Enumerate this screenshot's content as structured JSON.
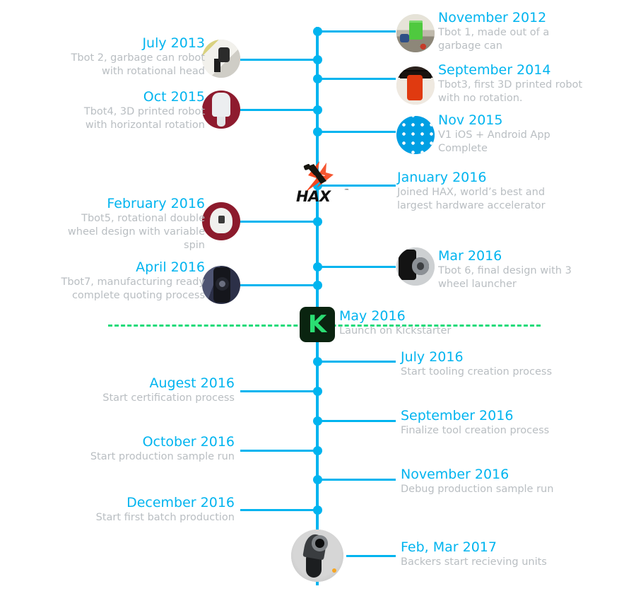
{
  "meta": {
    "title": "Product Development Timeline",
    "accent_blue": "#00b4ef",
    "muted_gray": "#b9bec2",
    "kickstarter_green": "#2bde73",
    "dash_green": "#1ddb7a",
    "badge_dark": "#0a2410"
  },
  "kickstarter": {
    "badge_letter": "K",
    "date": "May 2016",
    "desc": "Launch on Kickstarter"
  },
  "hax": {
    "wordmark": "HAX",
    "trademark": "™"
  },
  "entries": [
    {
      "side": "right",
      "date": "November 2012",
      "desc": "Tbot 1, made out of a garbage can",
      "image": "tbot1-photo"
    },
    {
      "side": "left",
      "date": "July 2013",
      "desc": "Tbot 2, garbage can robot with rotational head",
      "image": "tbot2-photo"
    },
    {
      "side": "right",
      "date": "September 2014",
      "desc": "Tbot3, first 3D printed robot with no rotation.",
      "image": "tbot3-photo"
    },
    {
      "side": "left",
      "date": "Oct 2015",
      "desc": "Tbot4, 3D printed robot with horizontal rotation",
      "image": "tbot4-photo"
    },
    {
      "side": "right",
      "date": "Nov 2015",
      "desc": "V1 iOS + Android App Complete",
      "image": "app-icon"
    },
    {
      "side": "right",
      "date": "January 2016",
      "desc": "Joined HAX, world’s best and largest hardware accelerator",
      "image": "hax-logo"
    },
    {
      "side": "left",
      "date": "February 2016",
      "desc": "Tbot5, rotational double wheel design with variable spin",
      "image": "tbot5-photo"
    },
    {
      "side": "right",
      "date": "Mar 2016",
      "desc": "Tbot 6, final design with 3 wheel launcher",
      "image": "tbot6-photo"
    },
    {
      "side": "left",
      "date": "April 2016",
      "desc": "Tbot7, manufacturing ready complete quoting process",
      "image": "tbot7-photo"
    },
    {
      "side": "right",
      "date": "July 2016",
      "desc": "Start tooling creation process",
      "image": null
    },
    {
      "side": "left",
      "date": "Augest 2016",
      "desc": "Start certification process",
      "image": null
    },
    {
      "side": "right",
      "date": "September 2016",
      "desc": "Finalize tool creation process",
      "image": null
    },
    {
      "side": "left",
      "date": "October 2016",
      "desc": "Start production sample run",
      "image": null
    },
    {
      "side": "right",
      "date": "November 2016",
      "desc": "Debug production sample run",
      "image": null
    },
    {
      "side": "left",
      "date": "December 2016",
      "desc": "Start first batch production",
      "image": null
    },
    {
      "side": "right",
      "date": "Feb, Mar 2017",
      "desc": "Backers start recieving units",
      "image": "final-product-photo"
    }
  ]
}
